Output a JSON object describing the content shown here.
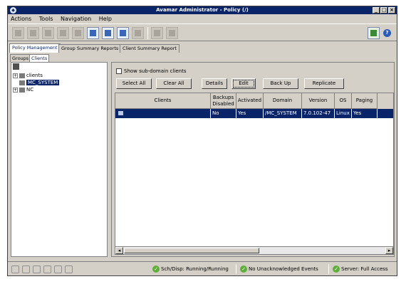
{
  "window": {
    "title": "Avamar Administrator - Policy (/)"
  },
  "menu": [
    "Actions",
    "Tools",
    "Navigation",
    "Help"
  ],
  "main_tabs": [
    "Policy Management",
    "Group Summary Reports",
    "Client Summary Report"
  ],
  "sub_tabs": [
    "Groups",
    "Clients"
  ],
  "tree": {
    "root": "clients",
    "selected": "MC_SYSTEM",
    "node3": "NC"
  },
  "options": {
    "show_subdomain": "Show sub-domain clients"
  },
  "buttons": {
    "select_all": "Select All",
    "clear_all": "Clear All",
    "details": "Details",
    "edit": "Edit",
    "back_up": "Back Up",
    "replicate": "Replicate"
  },
  "table": {
    "headers": [
      "Clients",
      "Backups Disabled",
      "Activated",
      "Domain",
      "Version",
      "OS",
      "Paging"
    ],
    "rows": [
      {
        "client": "",
        "backups_disabled": "No",
        "activated": "Yes",
        "domain": "/MC_SYSTEM",
        "version": "7.0.102-47",
        "os": "Linux",
        "paging": "Yes"
      }
    ]
  },
  "status": {
    "sch_disp": "Sch/Disp: Running/Running",
    "unack": "No Unacknowledged Events",
    "server": "Server: Full Access"
  }
}
